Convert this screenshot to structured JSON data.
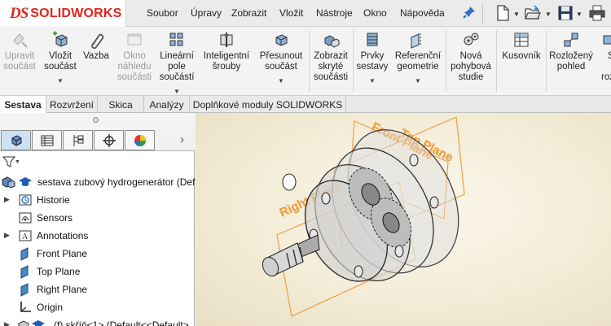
{
  "logo": {
    "mark": "DS",
    "text": "SOLIDWORKS"
  },
  "menu": [
    "Soubor",
    "Úpravy",
    "Zobrazit",
    "Vložit",
    "Nástroje",
    "Okno",
    "Nápověda"
  ],
  "quick_access": [
    {
      "icon": "new-document-icon"
    },
    {
      "icon": "open-folder-icon"
    },
    {
      "icon": "save-icon"
    },
    {
      "icon": "print-icon"
    }
  ],
  "ribbon": {
    "tools": [
      {
        "lines": [
          "Upravit",
          "součást"
        ],
        "icon": "edit-part-icon",
        "enabled": false,
        "dropdown": false
      },
      {
        "lines": [
          "Vložit",
          "součást"
        ],
        "icon": "insert-component-icon",
        "enabled": true,
        "dropdown": true
      },
      {
        "lines": [
          "Vazba"
        ],
        "icon": "mate-icon",
        "enabled": true,
        "dropdown": false
      },
      {
        "lines": [
          "Okno",
          "náhledu",
          "součásti"
        ],
        "icon": "preview-window-icon",
        "enabled": false,
        "dropdown": false
      },
      {
        "lines": [
          "Lineární",
          "pole",
          "součástí"
        ],
        "icon": "linear-pattern-icon",
        "enabled": true,
        "dropdown": true
      },
      {
        "lines": [
          "Inteligentní",
          "šrouby"
        ],
        "icon": "smart-fasteners-icon",
        "enabled": true,
        "dropdown": false
      },
      {
        "lines": [
          "Přesunout",
          "součást"
        ],
        "icon": "move-component-icon",
        "enabled": true,
        "dropdown": true
      },
      {
        "lines": [
          "Zobrazit",
          "skryté",
          "součásti"
        ],
        "icon": "show-hidden-icon",
        "enabled": true,
        "dropdown": false
      },
      {
        "lines": [
          "Prvky",
          "sestavy"
        ],
        "icon": "assembly-features-icon",
        "enabled": true,
        "dropdown": true
      },
      {
        "lines": [
          "Referenční",
          "geometrie"
        ],
        "icon": "reference-geometry-icon",
        "enabled": true,
        "dropdown": true
      },
      {
        "lines": [
          "Nová",
          "pohybová",
          "studie"
        ],
        "icon": "motion-study-icon",
        "enabled": true,
        "dropdown": false
      },
      {
        "lines": [
          "Kusovník"
        ],
        "icon": "bom-icon",
        "enabled": true,
        "dropdown": false
      },
      {
        "lines": [
          "Rozložený",
          "pohled"
        ],
        "icon": "exploded-view-icon",
        "enabled": true,
        "dropdown": false
      },
      {
        "lines": [
          "S",
          "",
          "roz"
        ],
        "icon": "explode-line-icon",
        "enabled": true,
        "dropdown": false
      }
    ]
  },
  "tabs": [
    {
      "label": "Sestava",
      "active": true
    },
    {
      "label": "Rozvržení",
      "active": false
    },
    {
      "label": "Skica",
      "active": false
    },
    {
      "label": "Analýzy",
      "active": false
    },
    {
      "label": "Doplňkové moduly SOLIDWORKS",
      "active": false
    }
  ],
  "panel_tabs": [
    {
      "icon": "feature-manager-icon",
      "active": true
    },
    {
      "icon": "property-manager-icon",
      "active": false
    },
    {
      "icon": "configuration-manager-icon",
      "active": false
    },
    {
      "icon": "dimxpert-icon",
      "active": false
    },
    {
      "icon": "display-manager-icon",
      "active": false
    }
  ],
  "tree": [
    {
      "label": "sestava zubový hydrogenerátor  (Def",
      "icon": "assembly-icon",
      "expand": false
    },
    {
      "label": "Historie",
      "icon": "history-icon",
      "expand": true
    },
    {
      "label": "Sensors",
      "icon": "sensors-icon",
      "expand": false
    },
    {
      "label": "Annotations",
      "icon": "annotations-icon",
      "expand": true
    },
    {
      "label": "Front Plane",
      "icon": "plane-icon",
      "expand": false
    },
    {
      "label": "Top Plane",
      "icon": "plane-icon",
      "expand": false
    },
    {
      "label": "Right Plane",
      "icon": "plane-icon",
      "expand": false
    },
    {
      "label": "Origin",
      "icon": "origin-icon",
      "expand": false
    },
    {
      "label": "(f) skříň<1> (Default<<Default>",
      "icon": "part-icon",
      "expand": true
    }
  ],
  "viewport": {
    "plane_labels": [
      "Right Plane",
      "Front Plane",
      "Top Plane"
    ],
    "plane_color": "#f0a040",
    "model_color": "#c8c8c8"
  }
}
